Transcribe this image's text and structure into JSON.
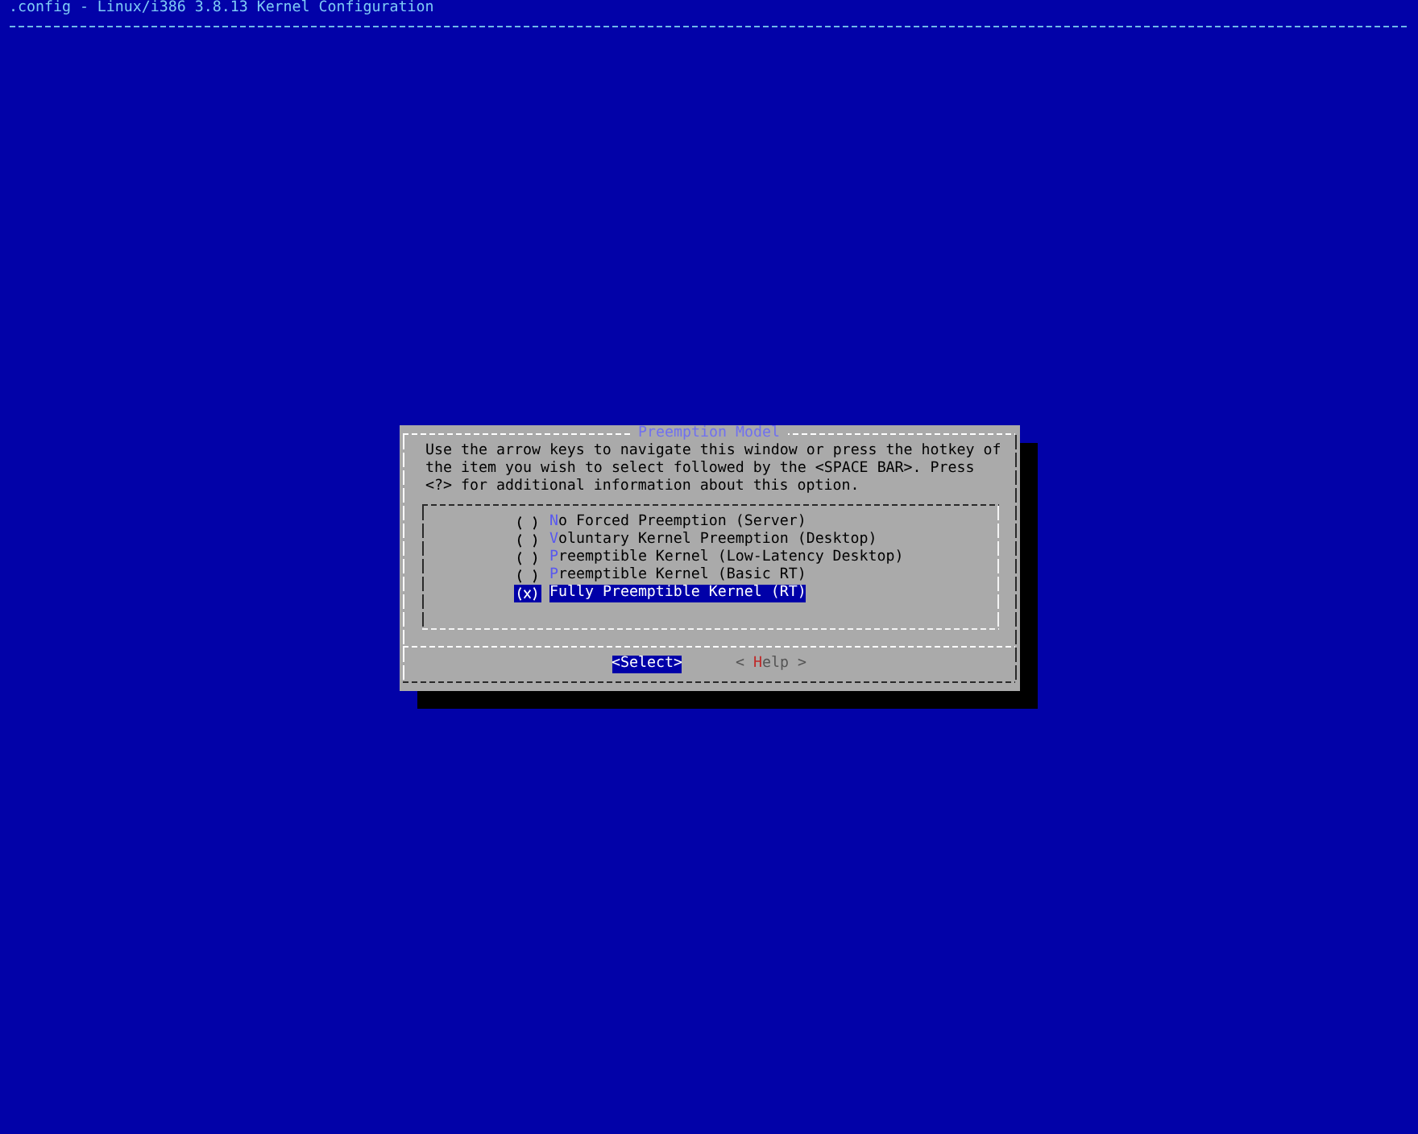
{
  "window": {
    "title": ".config - Linux/i386 3.8.13 Kernel Configuration"
  },
  "dialog": {
    "title": "Preemption Model",
    "prompt": "Use the arrow keys to navigate this window or press the hotkey of the item you wish to select followed by the <SPACE BAR>. Press <?> for additional information about this option.",
    "items": [
      {
        "label": "No Forced Preemption (Server)",
        "checked": false,
        "selected": false
      },
      {
        "label": "Voluntary Kernel Preemption (Desktop)",
        "checked": false,
        "selected": false
      },
      {
        "label": "Preemptible Kernel (Low-Latency Desktop)",
        "checked": false,
        "selected": false
      },
      {
        "label": "Preemptible Kernel (Basic RT)",
        "checked": false,
        "selected": false
      },
      {
        "label": "Fully Preemptible Kernel (RT)",
        "checked": true,
        "selected": true
      }
    ],
    "buttons": [
      {
        "label": "<Select>",
        "selected": true
      },
      {
        "label": "< Help >",
        "selected": false
      }
    ]
  }
}
